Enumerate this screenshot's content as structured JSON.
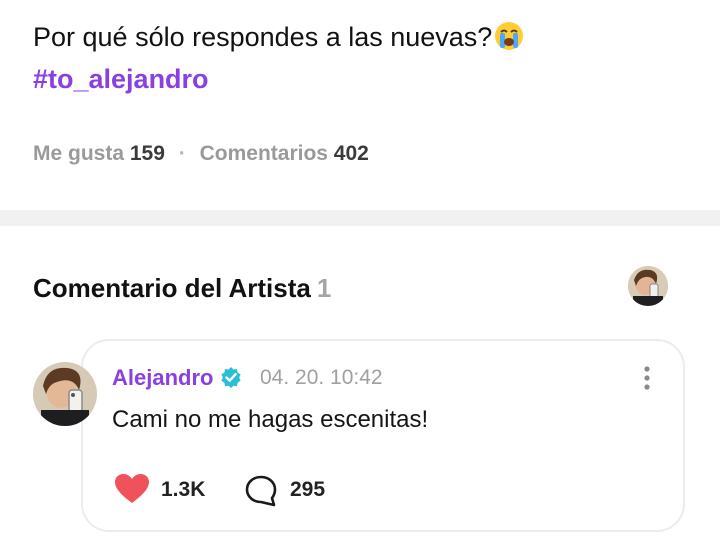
{
  "post": {
    "text": "Por qué sólo respondes a las nuevas?",
    "emoji": "crying-face-emoji",
    "hashtag": "#to_alejandro"
  },
  "stats": {
    "likes_label": "Me gusta",
    "likes_count": "159",
    "separator": "·",
    "comments_label": "Comentarios",
    "comments_count": "402"
  },
  "artist_comments": {
    "title": "Comentario del Artista",
    "count": "1"
  },
  "comment": {
    "author": "Alejandro",
    "verified_icon": "verified-badge-icon",
    "timestamp": "04. 20. 10:42",
    "text": "Cami no me hagas escenitas!",
    "likes": "1.3K",
    "replies": "295"
  },
  "colors": {
    "accent": "#8a3fe0",
    "like": "#f0525c",
    "verified": "#2bbfd6",
    "muted": "#9a9a9a",
    "divider": "#f1f1f1"
  }
}
